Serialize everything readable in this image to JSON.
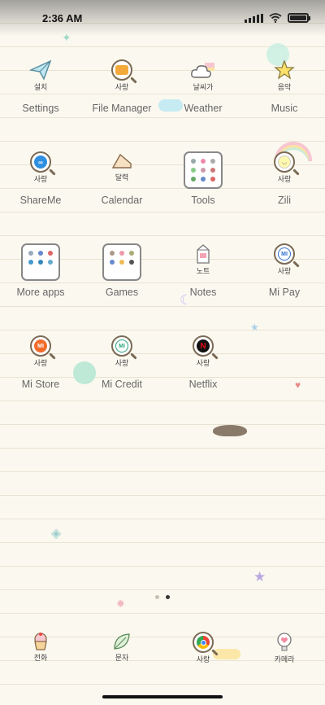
{
  "status_bar": {
    "time": "2:36 AM"
  },
  "apps": [
    [
      {
        "name": "settings",
        "icon": "paper-plane-icon",
        "sub": "설치",
        "label": "Settings"
      },
      {
        "name": "file-manager",
        "icon": "folder-magnifier-icon",
        "sub": "사랑",
        "label": "File Manager"
      },
      {
        "name": "weather",
        "icon": "cloud-rainbow-icon",
        "sub": "날씨가",
        "label": "Weather"
      },
      {
        "name": "music",
        "icon": "star-icon",
        "sub": "음악",
        "label": "Music"
      }
    ],
    [
      {
        "name": "shareme",
        "icon": "shareme-icon",
        "sub": "사랑",
        "label": "ShareMe"
      },
      {
        "name": "calendar",
        "icon": "cake-slice-icon",
        "sub": "달력",
        "label": "Calendar"
      },
      {
        "name": "tools",
        "icon": "folder-icon",
        "sub": "",
        "label": "Tools"
      },
      {
        "name": "zili",
        "icon": "zili-icon",
        "sub": "사랑",
        "label": "Zili"
      }
    ],
    [
      {
        "name": "more-apps",
        "icon": "folder-icon",
        "sub": "",
        "label": "More apps"
      },
      {
        "name": "games",
        "icon": "folder-icon",
        "sub": "",
        "label": "Games"
      },
      {
        "name": "notes",
        "icon": "milk-carton-icon",
        "sub": "노트",
        "label": "Notes"
      },
      {
        "name": "mi-pay",
        "icon": "mi-pay-icon",
        "sub": "사랑",
        "label": "Mi Pay"
      }
    ],
    [
      {
        "name": "mi-store",
        "icon": "mi-store-icon",
        "sub": "사랑",
        "label": "Mi Store"
      },
      {
        "name": "mi-credit",
        "icon": "mi-credit-icon",
        "sub": "사랑",
        "label": "Mi Credit"
      },
      {
        "name": "netflix",
        "icon": "netflix-icon",
        "sub": "사랑",
        "label": "Netflix"
      }
    ]
  ],
  "dock": [
    {
      "name": "phone",
      "icon": "cupcake-icon",
      "sub": "전화"
    },
    {
      "name": "messages",
      "icon": "leaf-icon",
      "sub": "문자"
    },
    {
      "name": "chrome",
      "icon": "chrome-icon",
      "sub": "사랑"
    },
    {
      "name": "camera",
      "icon": "lightbulb-heart-icon",
      "sub": "카메라"
    }
  ],
  "pages": {
    "count": 2,
    "current": 2
  }
}
